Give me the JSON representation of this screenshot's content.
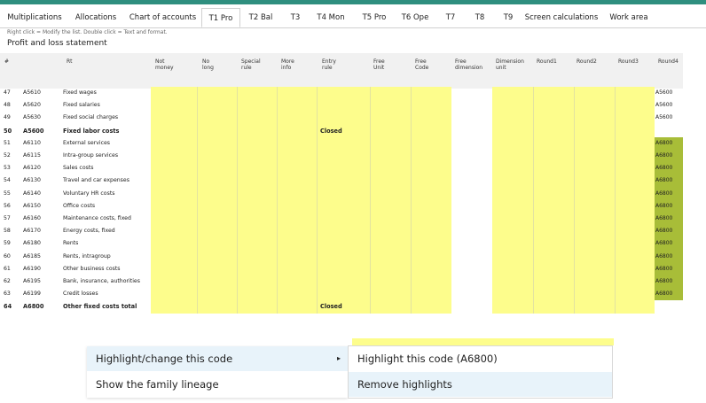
{
  "tabs": [
    {
      "label": "Multiplications",
      "active": false
    },
    {
      "label": "Allocations",
      "active": false
    },
    {
      "label": "Chart of accounts",
      "active": false
    },
    {
      "label": "T1 Pro",
      "active": true
    },
    {
      "label": "T2 Bal",
      "active": false
    },
    {
      "label": "T3",
      "active": false
    },
    {
      "label": "T4 Mon",
      "active": false
    },
    {
      "label": "T5 Pro",
      "active": false
    },
    {
      "label": "T6 Ope",
      "active": false
    },
    {
      "label": "T7",
      "active": false
    },
    {
      "label": "T8",
      "active": false
    },
    {
      "label": "T9",
      "active": false
    },
    {
      "label": "Screen calculations",
      "active": false
    },
    {
      "label": "Work area",
      "active": false
    }
  ],
  "hint": "Right click = Modify the list. Double click = Text and format.",
  "page_title": "Profit and loss statement",
  "columns": [
    "#",
    "Rt",
    "Not\nmoney",
    "No\nlong",
    "Special\nrule",
    "More\ninfo",
    "Entry\nrule",
    "Free\nUnit",
    "Free\nCode",
    "Free\ndimension",
    "Dimension\nunit",
    "Round1",
    "Round2",
    "Round3",
    "Round4"
  ],
  "rows": [
    {
      "num": "47",
      "code": "A5610",
      "label": "Fixed wages",
      "bold": false,
      "entry": "",
      "round4": "A5600",
      "r4_style": "yellow"
    },
    {
      "num": "48",
      "code": "A5620",
      "label": "Fixed salaries",
      "bold": false,
      "entry": "",
      "round4": "A5600",
      "r4_style": "yellow"
    },
    {
      "num": "49",
      "code": "A5630",
      "label": "Fixed social charges",
      "bold": false,
      "entry": "",
      "round4": "A5600",
      "r4_style": "yellow"
    },
    {
      "num": "50",
      "code": "A5600",
      "label": "Fixed labor costs",
      "bold": true,
      "entry": "Closed",
      "round4": "",
      "r4_style": "yellow"
    },
    {
      "num": "51",
      "code": "A6110",
      "label": "External services",
      "bold": false,
      "entry": "",
      "round4": "A6800",
      "r4_style": "green"
    },
    {
      "num": "52",
      "code": "A6115",
      "label": "Intra-group services",
      "bold": false,
      "entry": "",
      "round4": "A6800",
      "r4_style": "green"
    },
    {
      "num": "53",
      "code": "A6120",
      "label": "Sales costs",
      "bold": false,
      "entry": "",
      "round4": "A6800",
      "r4_style": "green"
    },
    {
      "num": "54",
      "code": "A6130",
      "label": "Travel and car expenses",
      "bold": false,
      "entry": "",
      "round4": "A6800",
      "r4_style": "green"
    },
    {
      "num": "55",
      "code": "A6140",
      "label": "Voluntary HR costs",
      "bold": false,
      "entry": "",
      "round4": "A6800",
      "r4_style": "green"
    },
    {
      "num": "56",
      "code": "A6150",
      "label": "Office costs",
      "bold": false,
      "entry": "",
      "round4": "A6800",
      "r4_style": "green"
    },
    {
      "num": "57",
      "code": "A6160",
      "label": "Maintenance costs, fixed",
      "bold": false,
      "entry": "",
      "round4": "A6800",
      "r4_style": "green"
    },
    {
      "num": "58",
      "code": "A6170",
      "label": "Energy costs, fixed",
      "bold": false,
      "entry": "",
      "round4": "A6800",
      "r4_style": "green"
    },
    {
      "num": "59",
      "code": "A6180",
      "label": "Rents",
      "bold": false,
      "entry": "",
      "round4": "A6800",
      "r4_style": "green"
    },
    {
      "num": "60",
      "code": "A6185",
      "label": "Rents, intragroup",
      "bold": false,
      "entry": "",
      "round4": "A6800",
      "r4_style": "green"
    },
    {
      "num": "61",
      "code": "A6190",
      "label": "Other business costs",
      "bold": false,
      "entry": "",
      "round4": "A6800",
      "r4_style": "green"
    },
    {
      "num": "62",
      "code": "A6195",
      "label": "Bank, insurance, authorities",
      "bold": false,
      "entry": "",
      "round4": "A6800",
      "r4_style": "green"
    },
    {
      "num": "63",
      "code": "A6199",
      "label": "Credit losses",
      "bold": false,
      "entry": "",
      "round4": "A6800",
      "r4_style": "green"
    },
    {
      "num": "64",
      "code": "A6800",
      "label": "Other fixed costs total",
      "bold": true,
      "entry": "Closed",
      "round4": "",
      "r4_style": "yellow"
    }
  ],
  "context_menu": {
    "items": [
      {
        "label": "Highlight/change this code",
        "highlighted": true,
        "has_submenu": true
      },
      {
        "label": "Show the family lineage",
        "highlighted": false,
        "has_submenu": false
      }
    ],
    "submenu_arrow": "▸",
    "submenu": [
      {
        "label": "Highlight this code (A6800)",
        "highlighted": false
      },
      {
        "label": "Remove highlights",
        "highlighted": true
      }
    ]
  },
  "colors": {
    "accent_line": "#2f8f7f",
    "cell_yellow": "#fdfd8c",
    "cell_green": "#a8bd38",
    "menu_highlight": "#e8f3fa"
  }
}
